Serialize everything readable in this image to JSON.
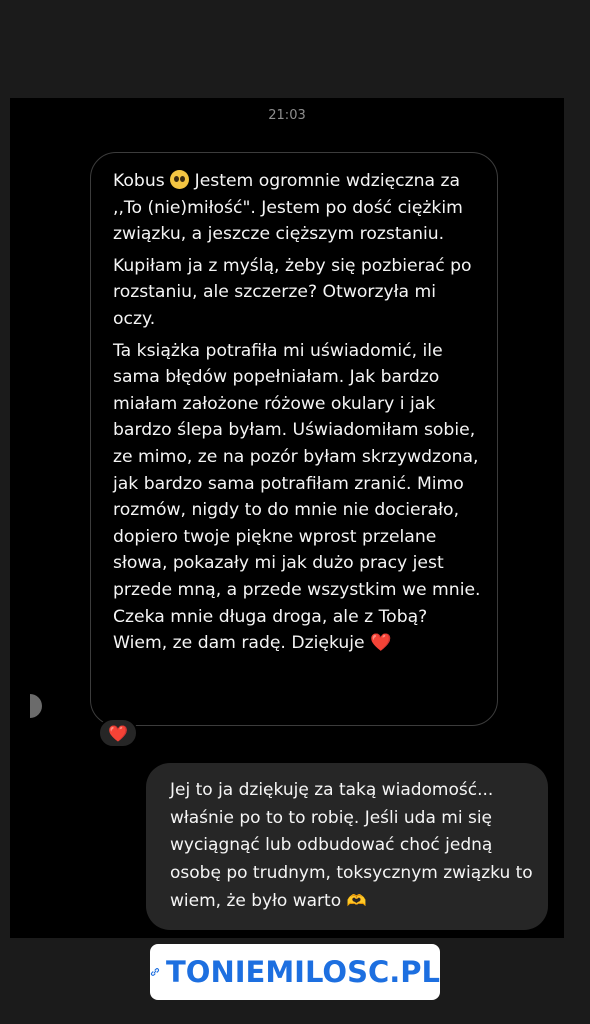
{
  "chat": {
    "timestamp": "21:03",
    "received": {
      "name_prefix": "Kobus",
      "line1_rest": " Jestem ogromnie wdzięczna za ,,To (nie)miłość\".  Jestem po dość ciężkim związku, a jeszcze cięższym rozstaniu.",
      "paragraph2": "Kupiłam ja z myślą, żeby się pozbierać po rozstaniu, ale szczerze? Otworzyła mi oczy.",
      "paragraph3": "Ta książka potrafiła mi uświadomić, ile sama błędów popełniałam. Jak bardzo miałam założone różowe okulary i jak bardzo ślepa byłam. Uświadomiłam sobie, ze mimo, ze na pozór byłam skrzywdzona, jak bardzo sama potrafiłam zranić. Mimo rozmów, nigdy to do mnie nie docierało, dopiero twoje piękne wprost przelane słowa, pokazały mi jak dużo pracy jest przede mną, a przede wszystkim we mnie. Czeka mnie długa droga, ale z Tobą? Wiem, ze dam radę. Dziękuje",
      "end_emoji": "❤️",
      "reaction": "❤️"
    },
    "sent": {
      "text": "Jej to ja dziękuję za taką wiadomość... właśnie po to to robię. Jeśli uda mi się wyciągnąć lub odbudować choć jedną osobę po trudnym, toksycznym związku to wiem, że było warto",
      "end_emoji": "🫶"
    }
  },
  "link_sticker": {
    "label": "TONIEMILOSC.PL",
    "icon": "link-icon",
    "color": "#1d6fe0"
  }
}
